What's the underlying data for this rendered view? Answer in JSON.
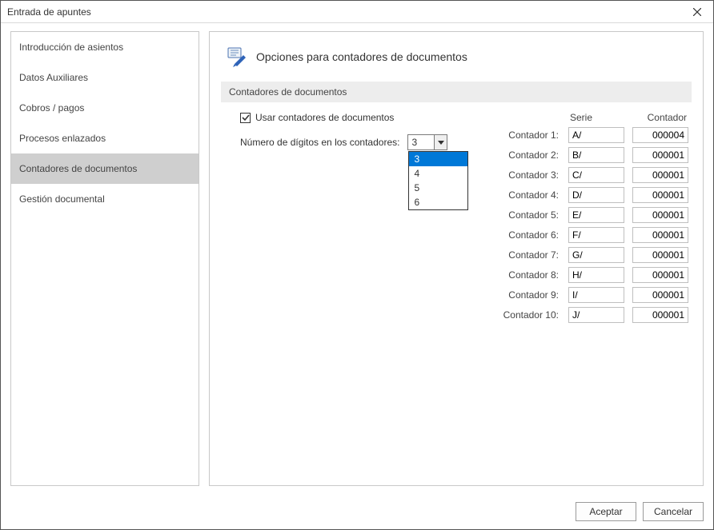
{
  "window": {
    "title": "Entrada de apuntes"
  },
  "sidebar": {
    "items": [
      {
        "label": "Introducción de asientos",
        "selected": false
      },
      {
        "label": "Datos Auxiliares",
        "selected": false
      },
      {
        "label": "Cobros / pagos",
        "selected": false
      },
      {
        "label": "Procesos enlazados",
        "selected": false
      },
      {
        "label": "Contadores de documentos",
        "selected": true
      },
      {
        "label": "Gestión documental",
        "selected": false
      }
    ]
  },
  "panel": {
    "title": "Opciones para contadores de documentos",
    "section": "Contadores de documentos",
    "use_counters_label": "Usar contadores de documentos",
    "use_counters_checked": true,
    "digits_label": "Número de dígitos en los contadores:",
    "digits_value": "3",
    "digits_options": [
      "3",
      "4",
      "5",
      "6"
    ],
    "headers": {
      "serie": "Serie",
      "contador": "Contador"
    },
    "counters": [
      {
        "label": "Contador 1:",
        "serie": "A/",
        "contador": "000004"
      },
      {
        "label": "Contador 2:",
        "serie": "B/",
        "contador": "000001"
      },
      {
        "label": "Contador 3:",
        "serie": "C/",
        "contador": "000001"
      },
      {
        "label": "Contador 4:",
        "serie": "D/",
        "contador": "000001"
      },
      {
        "label": "Contador 5:",
        "serie": "E/",
        "contador": "000001"
      },
      {
        "label": "Contador 6:",
        "serie": "F/",
        "contador": "000001"
      },
      {
        "label": "Contador 7:",
        "serie": "G/",
        "contador": "000001"
      },
      {
        "label": "Contador 8:",
        "serie": "H/",
        "contador": "000001"
      },
      {
        "label": "Contador 9:",
        "serie": "I/",
        "contador": "000001"
      },
      {
        "label": "Contador 10:",
        "serie": "J/",
        "contador": "000001"
      }
    ]
  },
  "footer": {
    "accept": "Aceptar",
    "cancel": "Cancelar"
  }
}
